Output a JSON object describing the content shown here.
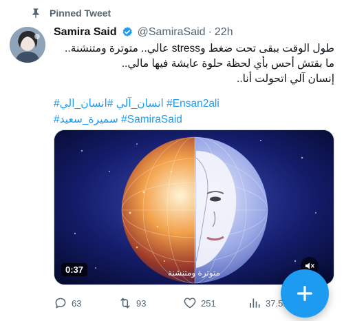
{
  "pinned": {
    "label": "Pinned Tweet",
    "icon": "pin-icon"
  },
  "author": {
    "display_name": "Samira Said",
    "verified_icon": "verified-icon",
    "handle": "@SamiraSaid",
    "separator": "·",
    "time": "22h"
  },
  "body": {
    "lines": [
      "طول الوقت ببقى تحت ضغط وstress عالي.. متوترة ومتنشنة..",
      "ما بقتش أحس بأي لحظة حلوة عايشة فيها مالي..",
      "إنسان آلي اتحولت أنا.."
    ]
  },
  "hashtags": {
    "line1": [
      "#Ensan2ali",
      "#انسان_الي",
      "#انسان_آلي"
    ],
    "line2": [
      "#SamiraSaid",
      "#سميرة_سعيد"
    ]
  },
  "media": {
    "duration": "0:37",
    "caption": "متوترة ومتنشنة",
    "mute_icon": "speaker-muted-icon"
  },
  "actions": {
    "replies": "63",
    "retweets": "93",
    "likes": "251",
    "views": "37.5K"
  },
  "colors": {
    "accent": "#1d9bf0",
    "muted_text": "#536471",
    "text": "#0f1419"
  },
  "fab": {
    "icon": "plus-icon"
  }
}
